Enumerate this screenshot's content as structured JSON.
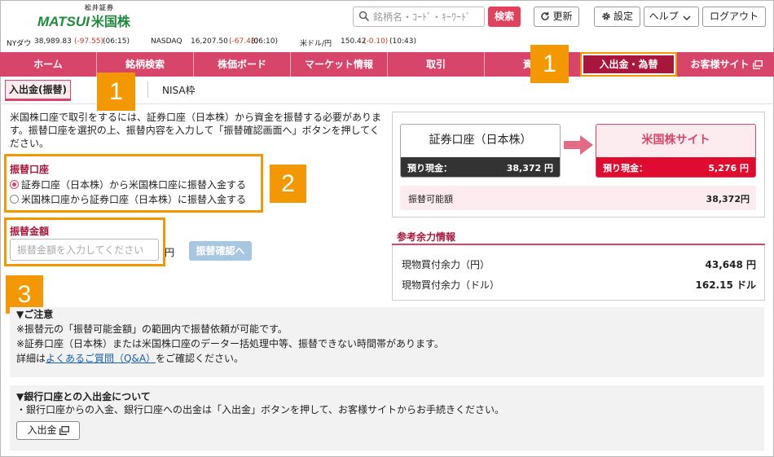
{
  "header": {
    "logo_top": "松井証券",
    "logo_main": "MATSUI",
    "logo_sub": "米国株",
    "search_placeholder": "銘柄名・ｺｰﾄﾞ・ｷｰﾜｰﾄﾞ",
    "search_button": "検索",
    "refresh_label": "更新",
    "settings_label": "設定",
    "help_label": "ヘルプ",
    "logout_label": "ログアウト"
  },
  "ticker": {
    "dow_label": "NYダウ",
    "dow_value": "38,989.83",
    "dow_change": "(-97.55)",
    "dow_time": "(06:15)",
    "nasdaq_label": "NASDAQ",
    "nasdaq_value": "16,207.50",
    "nasdaq_change": "(-67.43)",
    "nasdaq_time": "(06:10)",
    "fx_label": "米ドル/円",
    "fx_value": "150.42",
    "fx_change": "(-0.10)",
    "fx_time": "(10:43)"
  },
  "nav": {
    "items": [
      "ホーム",
      "銘柄検索",
      "株価ボード",
      "マーケット情報",
      "取引",
      "資産",
      "入出金・為替",
      "お客様サイト"
    ]
  },
  "subtabs": {
    "active": "入出金(振替)",
    "other": "NISA枠"
  },
  "badges": [
    "1",
    "1",
    "2",
    "3"
  ],
  "form": {
    "intro": "米国株口座で取引をするには、証券口座（日本株）から資金を振替する必要があります。振替口座を選択の上、振替内容を入力して「振替確認画面へ」ボタンを押してください。",
    "account_label": "振替口座",
    "option1": "証券口座（日本株）から米国株口座に振替入金する",
    "option2": "米国株口座から証券口座（日本株）に振替入金する",
    "amount_label": "振替金額",
    "amount_placeholder": "振替金額を入力してください",
    "unit": "円",
    "confirm_button": "振替確認へ"
  },
  "summary": {
    "securities_title": "証券口座（日本株）",
    "securities_cash_label": "預り現金：",
    "securities_cash_value": "38,372 円",
    "us_title": "米国株サイト",
    "us_cash_label": "預り現金：",
    "us_cash_value": "5,276 円",
    "available_label": "振替可能額",
    "available_value": "38,372円"
  },
  "reference": {
    "title": "参考余力情報",
    "row1_label": "現物買付余力（円）",
    "row1_value": "43,648 円",
    "row2_label": "現物買付余力（ドル）",
    "row2_value": "162.15 ドル"
  },
  "notice": {
    "title": "▼ご注意",
    "line1": "※振替元の「振替可能金額」の範囲内で振替依頼が可能です。",
    "line2": "※証券口座（日本株）または米国株口座のデーター括処理中等、振替できない時間帯があります。",
    "line3_pre": "詳細は",
    "line3_link": "よくあるご質問（Q&A）",
    "line3_post": "をご確認ください。"
  },
  "bank": {
    "title": "▼銀行口座との入出金について",
    "line1": "・銀行口座からの入金、銀行口座への出金は「入出金」ボタンを押して、お客様サイトからお手続きください。",
    "button": "入出金"
  },
  "colors": {
    "nav_bg": "#d8456a",
    "nav_active": "#a8173b",
    "accent_orange": "#f39800",
    "brand_green": "#1e8a3a",
    "us_cash_bar": "#e00c2f"
  }
}
